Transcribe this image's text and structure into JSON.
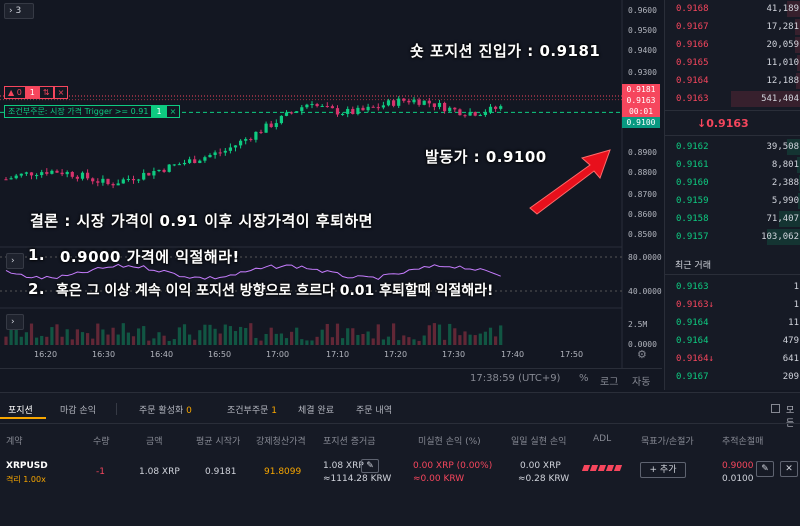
{
  "chart": {
    "nav_collapse_label": "3",
    "price_ticks": [
      "0.9600",
      "0.9500",
      "0.9400",
      "0.9300",
      "0.9200",
      "0.9100",
      "0.9000",
      "0.8900",
      "0.8800",
      "0.8700",
      "0.8600",
      "0.8500"
    ],
    "indicator_ticks": [
      "80.0000",
      "40.0000"
    ],
    "volume_ticks": [
      "2.5M",
      "0.0000"
    ],
    "price_tags": [
      {
        "value": "0.9181",
        "color": "#f6465d"
      },
      {
        "value": "0.9163",
        "color": "#f6465d"
      },
      {
        "value": "00:01",
        "color": "#f6465d"
      },
      {
        "value": "0.9100",
        "color": "#089981"
      }
    ],
    "time_ticks": [
      "16:20",
      "16:30",
      "16:40",
      "16:50",
      "17:00",
      "17:10",
      "17:20",
      "17:30",
      "17:40",
      "17:50"
    ],
    "status": {
      "clock": "17:38:59 (UTC+9)",
      "percent": "%",
      "log": "로그",
      "auto": "자동"
    },
    "position_line": {
      "qty": "0",
      "count": "1",
      "close": "×"
    },
    "trigger_line": {
      "label": "조건부주문: 시장 가격 Trigger >= 0.91",
      "count": "1",
      "close": "×"
    }
  },
  "annotations": {
    "entry": "숏 포지션 진입가 : 0.9181",
    "trigger": "발동가 : 0.9100",
    "conclusion": "결론 : 시장 가격이 0.91 이후 시장가격이 후퇴하면",
    "item1_num": "1.",
    "item1": "0.9000 가격에 익절해라!",
    "item2_num": "2.",
    "item2": "혹은 그 이상 계속 이익 포지션 방향으로 흐르다 0.01 후퇴할때 익절해라!"
  },
  "orderbook": {
    "asks": [
      {
        "price": "0.9168",
        "qty": "41,189"
      },
      {
        "price": "0.9167",
        "qty": "17,281"
      },
      {
        "price": "0.9166",
        "qty": "20,059"
      },
      {
        "price": "0.9165",
        "qty": "11,010"
      },
      {
        "price": "0.9164",
        "qty": "12,188"
      },
      {
        "price": "0.9163",
        "qty": "541,404"
      }
    ],
    "last_price": "↓0.9163",
    "bids": [
      {
        "price": "0.9162",
        "qty": "39,508"
      },
      {
        "price": "0.9161",
        "qty": "8,801"
      },
      {
        "price": "0.9160",
        "qty": "2,388"
      },
      {
        "price": "0.9159",
        "qty": "5,990"
      },
      {
        "price": "0.9158",
        "qty": "71,407"
      },
      {
        "price": "0.9157",
        "qty": "103,062"
      }
    ],
    "recent_trades_title": "최근 거래",
    "trades": [
      {
        "price": "0.9163",
        "arrow": "",
        "qty": "1",
        "side": "bid"
      },
      {
        "price": "0.9163",
        "arrow": "↓",
        "qty": "1",
        "side": "ask"
      },
      {
        "price": "0.9164",
        "arrow": "",
        "qty": "11",
        "side": "bid"
      },
      {
        "price": "0.9164",
        "arrow": "",
        "qty": "479",
        "side": "bid"
      },
      {
        "price": "0.9164",
        "arrow": "↓",
        "qty": "641",
        "side": "ask"
      },
      {
        "price": "0.9167",
        "arrow": "",
        "qty": "209",
        "side": "bid"
      }
    ]
  },
  "bottom": {
    "tabs": [
      "포지션",
      "마감 손익",
      "주문 활성화",
      "조건부주문",
      "체결 완료",
      "주문 내역"
    ],
    "tab_counts": {
      "active_orders": "0",
      "conditional": "1"
    },
    "checkbox_label": "모든",
    "headers": [
      "계약",
      "수량",
      "금액",
      "평균 시작가",
      "강제청산가격",
      "포지션 증거금",
      "미실현 손익 (%)",
      "일일 실현 손익",
      "ADL",
      "목표가/손절가",
      "추적손절매"
    ],
    "row": {
      "symbol": "XRPUSD",
      "leverage": "격리 1.00x",
      "qty": "-1",
      "amount": "1.08 XRP",
      "avg_entry": "0.9181",
      "liq_price": "91.8099",
      "margin": "1.08 XRP",
      "margin_krw": "≈1114.28 KRW",
      "unrealized": "0.00 XRP (0.00%)",
      "unrealized_krw": "≈0.00 KRW",
      "realized": "0.00 XRP",
      "realized_krw": "≈0.28 KRW",
      "add_button": "+ 추가",
      "tp": "0.9000",
      "sl": "0.0100"
    }
  },
  "colors": {
    "up": "#0ecb81",
    "down": "#f6465d",
    "bg": "#131722",
    "panel": "#161a25",
    "accent": "#f7a600"
  }
}
